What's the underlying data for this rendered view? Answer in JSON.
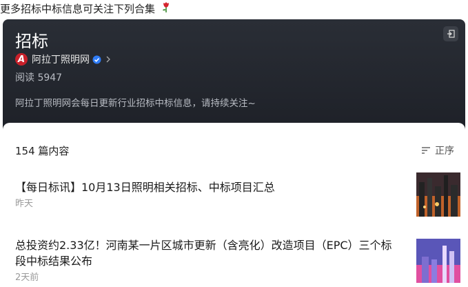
{
  "top_caption": "更多招标中标信息可关注下列合集",
  "collection": {
    "title": "招标",
    "account_name": "阿拉丁照明网",
    "avatar_letter": "A",
    "read_count": "阅读 5947",
    "description": "阿拉丁照明网会每日更新行业招标中标信息，请持续关注~"
  },
  "list": {
    "count_label": "154 篇内容",
    "sort_label": "正序",
    "articles": [
      {
        "title": "【每日标讯】10月13日照明相关招标、中标项目汇总",
        "date": "昨天"
      },
      {
        "title": "总投资约2.33亿！河南某一片区城市更新（含亮化）改造项目（EPC）三个标段中标结果公布",
        "date": "2天前"
      }
    ]
  },
  "colors": {
    "header_bg": "#23262d",
    "brand_red": "#c8202a",
    "verified_blue": "#2f7cf6"
  }
}
